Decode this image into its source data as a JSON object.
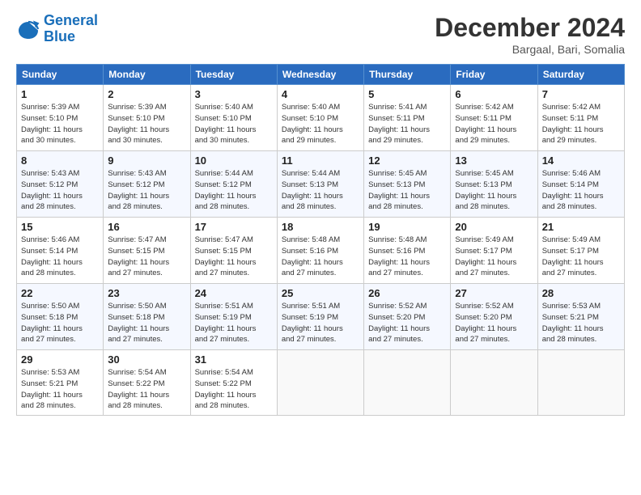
{
  "logo": {
    "line1": "General",
    "line2": "Blue"
  },
  "title": "December 2024",
  "subtitle": "Bargaal, Bari, Somalia",
  "header_days": [
    "Sunday",
    "Monday",
    "Tuesday",
    "Wednesday",
    "Thursday",
    "Friday",
    "Saturday"
  ],
  "weeks": [
    [
      {
        "day": "1",
        "info": "Sunrise: 5:39 AM\nSunset: 5:10 PM\nDaylight: 11 hours\nand 30 minutes."
      },
      {
        "day": "2",
        "info": "Sunrise: 5:39 AM\nSunset: 5:10 PM\nDaylight: 11 hours\nand 30 minutes."
      },
      {
        "day": "3",
        "info": "Sunrise: 5:40 AM\nSunset: 5:10 PM\nDaylight: 11 hours\nand 30 minutes."
      },
      {
        "day": "4",
        "info": "Sunrise: 5:40 AM\nSunset: 5:10 PM\nDaylight: 11 hours\nand 29 minutes."
      },
      {
        "day": "5",
        "info": "Sunrise: 5:41 AM\nSunset: 5:11 PM\nDaylight: 11 hours\nand 29 minutes."
      },
      {
        "day": "6",
        "info": "Sunrise: 5:42 AM\nSunset: 5:11 PM\nDaylight: 11 hours\nand 29 minutes."
      },
      {
        "day": "7",
        "info": "Sunrise: 5:42 AM\nSunset: 5:11 PM\nDaylight: 11 hours\nand 29 minutes."
      }
    ],
    [
      {
        "day": "8",
        "info": "Sunrise: 5:43 AM\nSunset: 5:12 PM\nDaylight: 11 hours\nand 28 minutes."
      },
      {
        "day": "9",
        "info": "Sunrise: 5:43 AM\nSunset: 5:12 PM\nDaylight: 11 hours\nand 28 minutes."
      },
      {
        "day": "10",
        "info": "Sunrise: 5:44 AM\nSunset: 5:12 PM\nDaylight: 11 hours\nand 28 minutes."
      },
      {
        "day": "11",
        "info": "Sunrise: 5:44 AM\nSunset: 5:13 PM\nDaylight: 11 hours\nand 28 minutes."
      },
      {
        "day": "12",
        "info": "Sunrise: 5:45 AM\nSunset: 5:13 PM\nDaylight: 11 hours\nand 28 minutes."
      },
      {
        "day": "13",
        "info": "Sunrise: 5:45 AM\nSunset: 5:13 PM\nDaylight: 11 hours\nand 28 minutes."
      },
      {
        "day": "14",
        "info": "Sunrise: 5:46 AM\nSunset: 5:14 PM\nDaylight: 11 hours\nand 28 minutes."
      }
    ],
    [
      {
        "day": "15",
        "info": "Sunrise: 5:46 AM\nSunset: 5:14 PM\nDaylight: 11 hours\nand 28 minutes."
      },
      {
        "day": "16",
        "info": "Sunrise: 5:47 AM\nSunset: 5:15 PM\nDaylight: 11 hours\nand 27 minutes."
      },
      {
        "day": "17",
        "info": "Sunrise: 5:47 AM\nSunset: 5:15 PM\nDaylight: 11 hours\nand 27 minutes."
      },
      {
        "day": "18",
        "info": "Sunrise: 5:48 AM\nSunset: 5:16 PM\nDaylight: 11 hours\nand 27 minutes."
      },
      {
        "day": "19",
        "info": "Sunrise: 5:48 AM\nSunset: 5:16 PM\nDaylight: 11 hours\nand 27 minutes."
      },
      {
        "day": "20",
        "info": "Sunrise: 5:49 AM\nSunset: 5:17 PM\nDaylight: 11 hours\nand 27 minutes."
      },
      {
        "day": "21",
        "info": "Sunrise: 5:49 AM\nSunset: 5:17 PM\nDaylight: 11 hours\nand 27 minutes."
      }
    ],
    [
      {
        "day": "22",
        "info": "Sunrise: 5:50 AM\nSunset: 5:18 PM\nDaylight: 11 hours\nand 27 minutes."
      },
      {
        "day": "23",
        "info": "Sunrise: 5:50 AM\nSunset: 5:18 PM\nDaylight: 11 hours\nand 27 minutes."
      },
      {
        "day": "24",
        "info": "Sunrise: 5:51 AM\nSunset: 5:19 PM\nDaylight: 11 hours\nand 27 minutes."
      },
      {
        "day": "25",
        "info": "Sunrise: 5:51 AM\nSunset: 5:19 PM\nDaylight: 11 hours\nand 27 minutes."
      },
      {
        "day": "26",
        "info": "Sunrise: 5:52 AM\nSunset: 5:20 PM\nDaylight: 11 hours\nand 27 minutes."
      },
      {
        "day": "27",
        "info": "Sunrise: 5:52 AM\nSunset: 5:20 PM\nDaylight: 11 hours\nand 27 minutes."
      },
      {
        "day": "28",
        "info": "Sunrise: 5:53 AM\nSunset: 5:21 PM\nDaylight: 11 hours\nand 28 minutes."
      }
    ],
    [
      {
        "day": "29",
        "info": "Sunrise: 5:53 AM\nSunset: 5:21 PM\nDaylight: 11 hours\nand 28 minutes."
      },
      {
        "day": "30",
        "info": "Sunrise: 5:54 AM\nSunset: 5:22 PM\nDaylight: 11 hours\nand 28 minutes."
      },
      {
        "day": "31",
        "info": "Sunrise: 5:54 AM\nSunset: 5:22 PM\nDaylight: 11 hours\nand 28 minutes."
      },
      {
        "day": "",
        "info": ""
      },
      {
        "day": "",
        "info": ""
      },
      {
        "day": "",
        "info": ""
      },
      {
        "day": "",
        "info": ""
      }
    ]
  ]
}
